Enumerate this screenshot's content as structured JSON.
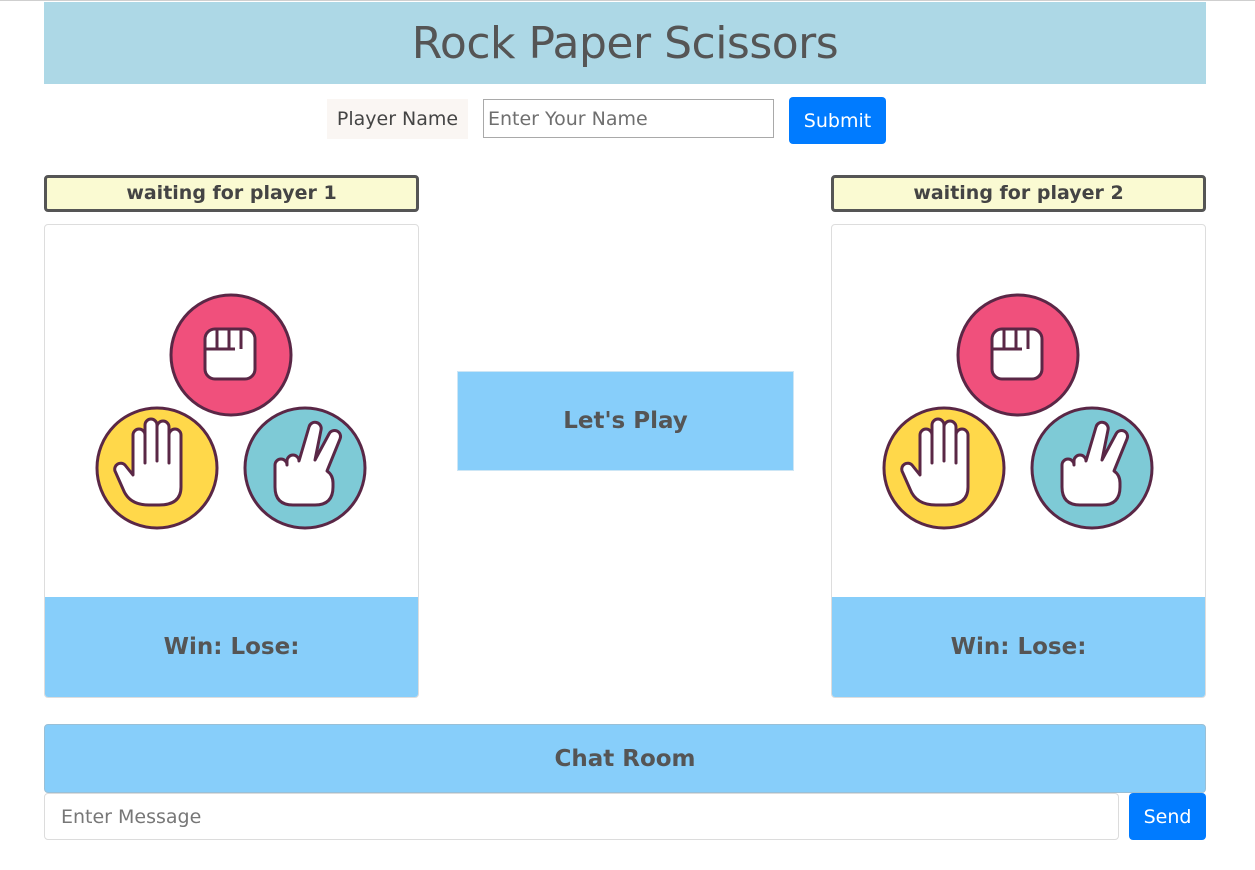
{
  "header": {
    "title": "Rock Paper Scissors"
  },
  "player_form": {
    "label": "Player Name",
    "placeholder": "Enter Your Name",
    "value": "",
    "submit_label": "Submit"
  },
  "players": [
    {
      "status": "waiting for player 1",
      "score_text": "Win: Lose:",
      "image": "rock-paper-scissors-hands-icon"
    },
    {
      "status": "waiting for player 2",
      "score_text": "Win: Lose:",
      "image": "rock-paper-scissors-hands-icon"
    }
  ],
  "center": {
    "play_label": "Let's Play"
  },
  "chat": {
    "title": "Chat Room",
    "placeholder": "Enter Message",
    "value": "",
    "send_label": "Send"
  },
  "colors": {
    "header_bg": "#add8e6",
    "panel_blue": "#87cefa",
    "button_blue": "#007bff",
    "status_bg": "#fafad2",
    "rock": "#f0507c",
    "paper": "#ffd84a",
    "scissors": "#7ecad6"
  }
}
